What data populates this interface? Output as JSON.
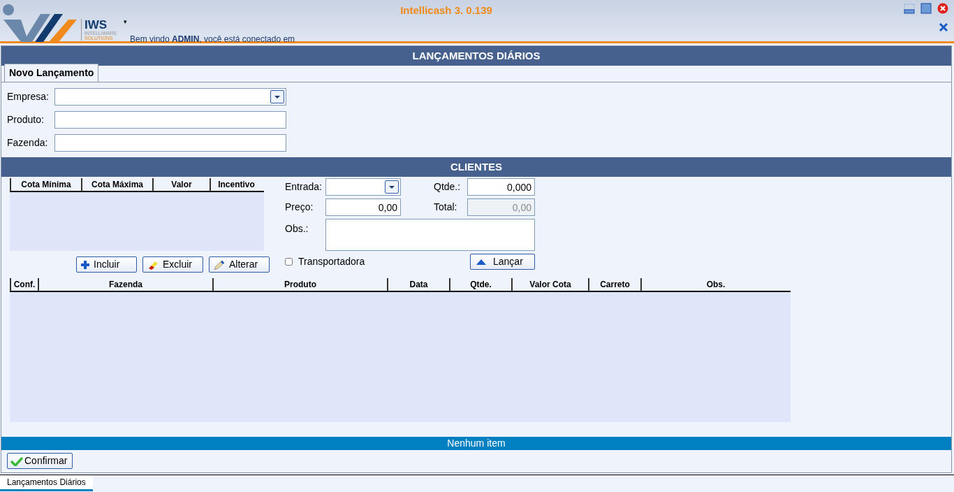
{
  "header": {
    "logo_text": "IWS",
    "logo_line1": "INTELLIWARE",
    "logo_line2": "SOLUTIONS",
    "menu_caret": "▾",
    "app_title": "Intellicash 3. 0.139",
    "welcome": "Bem vindo **ADMIN**, você está conectado em"
  },
  "page_title": "LANÇAMENTOS DIÁRIOS",
  "tabs": [
    {
      "label": "Novo Lançamento",
      "selected": true
    }
  ],
  "fields": [
    {
      "label": "Empresa:",
      "kind": "dropdown"
    },
    {
      "label": "Produto:",
      "kind": "text"
    },
    {
      "label": "Fazenda:",
      "kind": "text"
    }
  ],
  "clientes": {
    "title": "CLIENTES",
    "quota_columns": [
      "Cota Mínima",
      "Cota Máxima",
      "Valor",
      "Incentivo"
    ],
    "entrada": {
      "label": "Entrada:"
    },
    "qtde": {
      "label": "Qtde.:",
      "value": "0,000",
      "disabled": false
    },
    "preco": {
      "label": "Preço:",
      "value": "0,00",
      "disabled": false
    },
    "total": {
      "label": "Total:",
      "value": "0,00",
      "disabled": true
    },
    "obs": {
      "label": "Obs.:"
    },
    "buttons": [
      {
        "label": "Incluir",
        "kind": "plus"
      },
      {
        "label": "Excluir",
        "kind": "eraser"
      },
      {
        "label": "Alterar",
        "kind": "pencil"
      }
    ],
    "transportadora": {
      "label": "Transportadora",
      "checked": false
    },
    "lancar": {
      "label": "Lançar"
    }
  },
  "grid_columns": [
    "Conf.",
    "Fazenda",
    "Produto",
    "Data",
    "Qtde.",
    "Valor Cota",
    "Carreto",
    "Obs."
  ],
  "status": "Nenhum item",
  "confirm": {
    "label": "Confirmar"
  },
  "bottom_tabs": [
    {
      "label": "Lançamentos Diários",
      "selected": true
    }
  ]
}
